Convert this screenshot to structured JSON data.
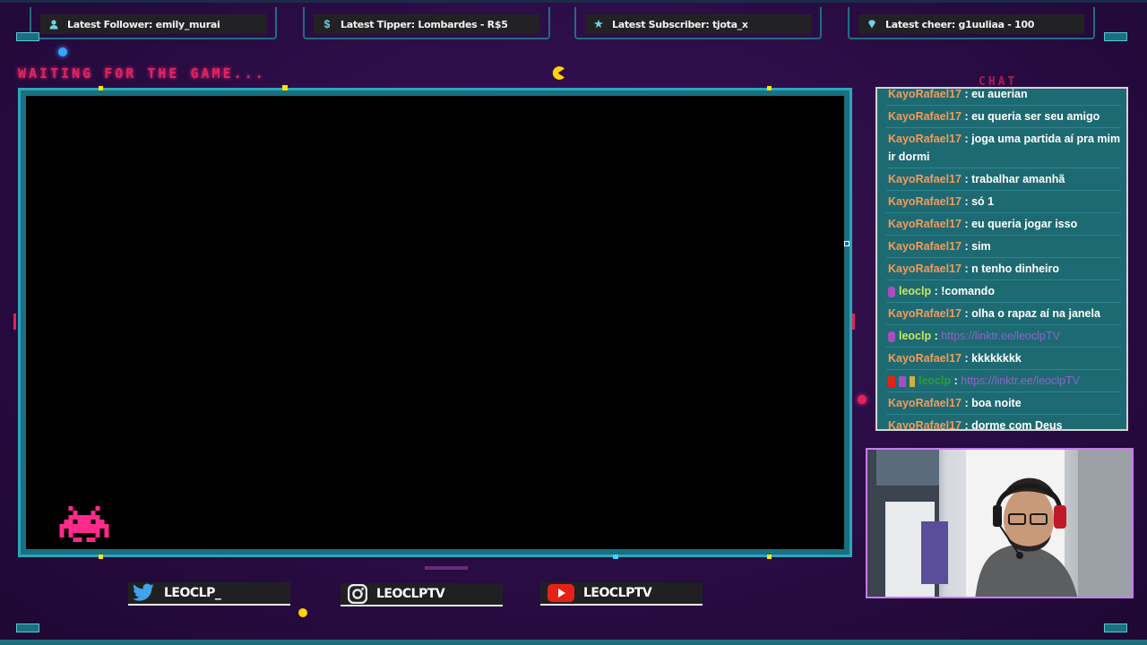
{
  "alerts": [
    {
      "icon": "user-icon",
      "text": "Latest Follower: emily_murai"
    },
    {
      "icon": "dollar-icon",
      "text": "Latest Tipper: Lombardes - R$5"
    },
    {
      "icon": "star-icon",
      "text": "Latest Subscriber: tjota_x"
    },
    {
      "icon": "diamond-icon",
      "text": "Latest cheer: g1uuliaa - 100"
    }
  ],
  "waiting_text": "WAITING FOR THE GAME...",
  "chat": {
    "title": "CHAT",
    "messages": [
      {
        "user": "KayoRafael17",
        "sep": " : ",
        "text": "eu auerian",
        "style": "normal"
      },
      {
        "user": "KayoRafael17",
        "sep": " : ",
        "text": "eu queria ser seu amigo",
        "style": "normal"
      },
      {
        "user": "KayoRafael17",
        "sep": " : ",
        "text": "joga uma partida aí pra mim ir dormi",
        "style": "normal"
      },
      {
        "user": "KayoRafael17",
        "sep": " : ",
        "text": "trabalhar amanhã",
        "style": "normal"
      },
      {
        "user": "KayoRafael17",
        "sep": " : ",
        "text": "só 1",
        "style": "normal"
      },
      {
        "user": "KayoRafael17",
        "sep": " : ",
        "text": "eu queria jogar isso",
        "style": "normal"
      },
      {
        "user": "KayoRafael17",
        "sep": " : ",
        "text": "sim",
        "style": "normal"
      },
      {
        "user": "KayoRafael17",
        "sep": " : ",
        "text": "n tenho dinheiro",
        "style": "normal"
      },
      {
        "user": "leoclp",
        "sep": " : ",
        "text": "!comando",
        "style": "leo"
      },
      {
        "user": "KayoRafael17",
        "sep": " : ",
        "text": "olha o rapaz aí na janela",
        "style": "normal"
      },
      {
        "user": "leoclp",
        "sep": " : ",
        "text": "https://linktr.ee/leoclpTV",
        "style": "leo-link"
      },
      {
        "user": "KayoRafael17",
        "sep": " : ",
        "text": "kkkkkkkk",
        "style": "normal"
      },
      {
        "user": "leoclp",
        "sep": " : ",
        "text": "https://linktr.ee/leoclpTV",
        "style": "green-link"
      },
      {
        "user": "KayoRafael17",
        "sep": " : ",
        "text": "boa noite",
        "style": "normal"
      },
      {
        "user": "KayoRafael17",
        "sep": " : ",
        "text": "dorme com Deus",
        "style": "normal"
      }
    ]
  },
  "socials": [
    {
      "icon": "twitter-icon",
      "label": "LEOCLP_"
    },
    {
      "icon": "instagram-icon",
      "label": "LEOCLPTV"
    },
    {
      "icon": "youtube-icon",
      "label": "LEOCLPTV"
    }
  ],
  "colors": {
    "accent_teal": "#2aa6ba",
    "accent_pink": "#e0245e",
    "chat_username": "#f39b5b",
    "broadcaster_username": "#c8e85c",
    "link": "#8b65c9"
  }
}
